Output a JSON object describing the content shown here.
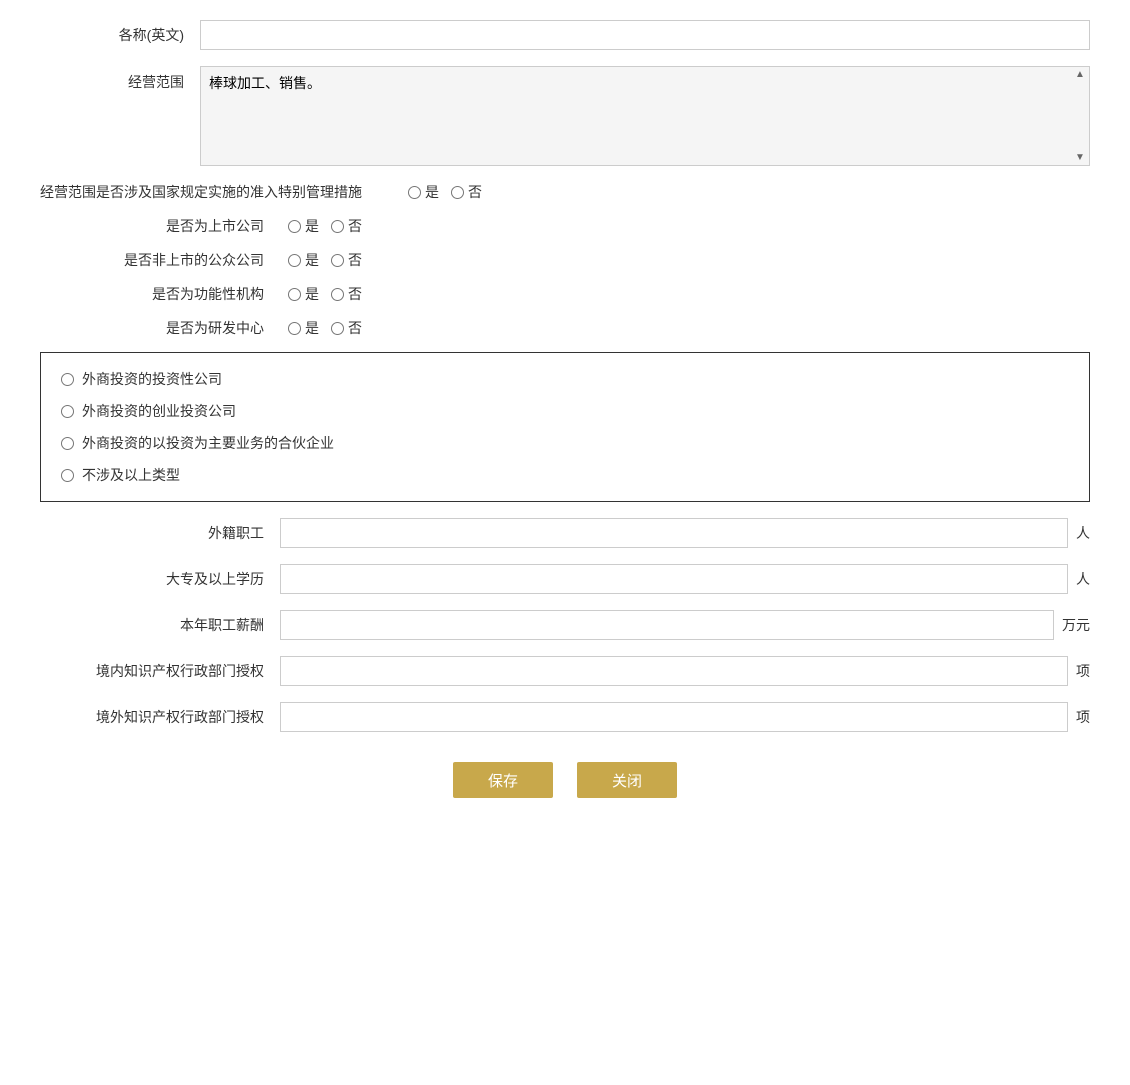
{
  "form": {
    "english_name_label": "各称(英文)",
    "english_name_value": "",
    "business_scope_label": "经营范围",
    "business_scope_value": "棒球加工、销售。",
    "special_management_label": "经营范围是否涉及国家规定实施的准入特别管理措施",
    "listed_company_label": "是否为上市公司",
    "non_listed_public_label": "是否非上市的公众公司",
    "functional_institution_label": "是否为功能性机构",
    "research_center_label": "是否为研发中心",
    "yes_label": "是",
    "no_label": "否",
    "foreign_investment_box": {
      "option1": "外商投资的投资性公司",
      "option2": "外商投资的创业投资公司",
      "option3": "外商投资的以投资为主要业务的合伙企业",
      "option4": "不涉及以上类型"
    },
    "foreign_employees_label": "外籍职工",
    "foreign_employees_unit": "人",
    "college_degree_label": "大专及以上学历",
    "college_degree_unit": "人",
    "annual_salary_label": "本年职工薪酬",
    "annual_salary_unit": "万元",
    "domestic_ip_label": "境内知识产权行政部门授权",
    "domestic_ip_unit": "项",
    "foreign_ip_label": "境外知识产权行政部门授权",
    "foreign_ip_unit": "项",
    "save_button": "保存",
    "close_button": "关闭"
  }
}
